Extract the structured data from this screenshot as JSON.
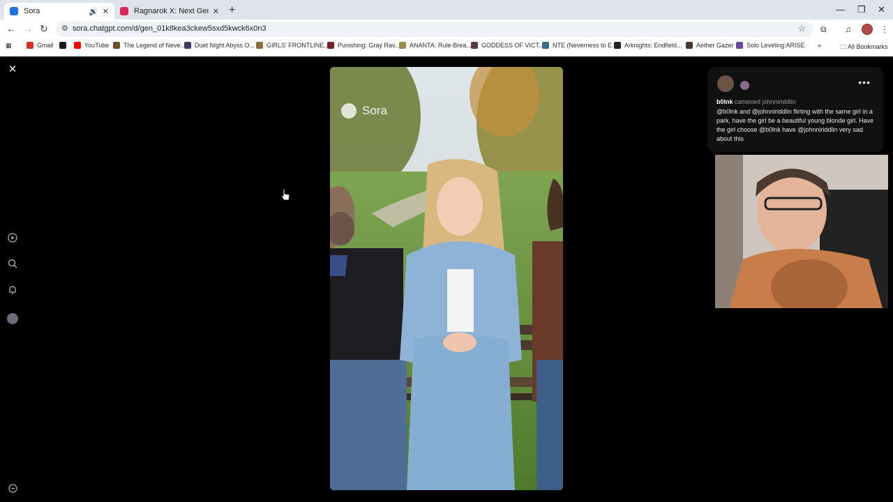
{
  "browser": {
    "tabs": [
      {
        "label": "Sora",
        "active": true,
        "favicon_color": "#1a73e8"
      },
      {
        "label": "Ragnarok X: Next Generation R",
        "active": false,
        "favicon_color": "#e0245e"
      }
    ],
    "url": "sora.chatgpt.com/d/gen_01k8kea3ckew5sxd5kwck6x0n3",
    "bookmarks": [
      {
        "label": "Gmail",
        "color": "#d93025"
      },
      {
        "label": "",
        "color": "#1b1b1b"
      },
      {
        "label": "YouTube",
        "color": "#ff0000"
      },
      {
        "label": "The Legend of Neve...",
        "color": "#6b4f2a"
      },
      {
        "label": "Duet Night Abyss O...",
        "color": "#3d3d5c"
      },
      {
        "label": "GIRLS' FRONTLINE...",
        "color": "#8a6d3b"
      },
      {
        "label": "Punishing: Gray Rav...",
        "color": "#7a1f2b"
      },
      {
        "label": "ANANTA: Rule-Brea...",
        "color": "#9a8c4a"
      },
      {
        "label": "GODDESS OF VICT...",
        "color": "#5a3a4a"
      },
      {
        "label": "NTE (Neverness to E...",
        "color": "#3a6b8a"
      },
      {
        "label": "Arknights: Endfield...",
        "color": "#222222"
      },
      {
        "label": "Aether Gazer",
        "color": "#4a3a2a"
      },
      {
        "label": "Solo Leveling:ARISE",
        "color": "#6a4aa0"
      }
    ],
    "all_bookmarks_label": "All Bookmarks"
  },
  "left_nav": {
    "close": "close-icon",
    "icons": [
      "play-circle-icon",
      "search-icon",
      "bell-icon",
      "profile-avatar"
    ],
    "bottom": "settings-icon"
  },
  "video": {
    "watermark": "Sora"
  },
  "caption": {
    "username": "b0lnk",
    "cameo_text": "cameoed johnniriddlin",
    "prompt": "@b0lnk and @johnniriddlin flirting with the same girl in a park, have the girl be a beautiful young blonde girl. Have the girl choose @b0lnk have @johnniriddlin very sad about this"
  },
  "colors": {
    "background": "#000000",
    "caption_bg": "#111111",
    "tabstrip": "#dfe3eb"
  }
}
